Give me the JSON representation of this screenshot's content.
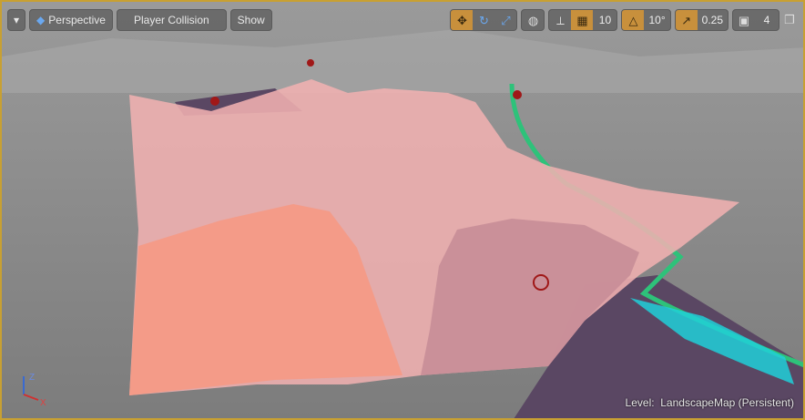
{
  "toolbar": {
    "view_mode": "Perspective",
    "show_mode": "Player Collision",
    "show_label": "Show",
    "grid_snap": "10",
    "rotation_snap": "10°",
    "scale_snap": "0.25",
    "camera_speed": "4",
    "icons": [
      "dropdown-icon",
      "perspective-icon",
      "translate-icon",
      "rotate-icon",
      "scale-icon",
      "world-local-icon",
      "surface-snap-icon",
      "grid-icon",
      "angle-icon",
      "scale-snap-icon",
      "camera-speed-icon",
      "maximize-icon"
    ]
  },
  "status": {
    "level_label": "Level:",
    "level_name": "LandscapeMap (Persistent)"
  },
  "axes": {
    "x": "X",
    "z": "Z"
  },
  "colors": {
    "accent": "#c8903c",
    "collision_light": "#f0b0b0",
    "collision_strong": "#f49a86",
    "water": "#5a4763",
    "river": "#2ec27a",
    "cyan": "#20d0d8"
  }
}
